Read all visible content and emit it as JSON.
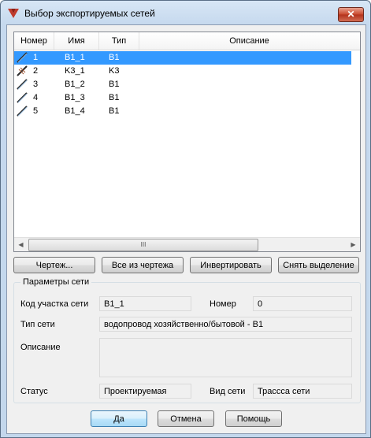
{
  "window": {
    "title": "Выбор экспортируемых сетей",
    "close_label": "✕"
  },
  "list": {
    "columns": [
      "Номер",
      "Имя",
      "Тип",
      "Описание"
    ],
    "rows": [
      {
        "num": "1",
        "name": "B1_1",
        "type": "B1",
        "desc": "",
        "icon": "pipe-icon",
        "selected": true
      },
      {
        "num": "2",
        "name": "K3_1",
        "type": "K3",
        "desc": "",
        "icon": "sewer-pipe-icon",
        "selected": false
      },
      {
        "num": "3",
        "name": "B1_2",
        "type": "B1",
        "desc": "",
        "icon": "pipe-icon",
        "selected": false
      },
      {
        "num": "4",
        "name": "B1_3",
        "type": "B1",
        "desc": "",
        "icon": "pipe-icon",
        "selected": false
      },
      {
        "num": "5",
        "name": "B1_4",
        "type": "B1",
        "desc": "",
        "icon": "pipe-icon",
        "selected": false
      }
    ],
    "scroll_left": "◀",
    "scroll_right": "▶",
    "scroll_grip": "III"
  },
  "actions": {
    "drawing": "Чертеж...",
    "all_from_drawing": "Все из чертежа",
    "invert": "Инвертировать",
    "deselect": "Снять выделение"
  },
  "params": {
    "group_title": "Параметры сети",
    "section_code_label": "Код участка сети",
    "section_code_value": "B1_1",
    "number_label": "Номер",
    "number_value": "0",
    "net_type_label": "Тип сети",
    "net_type_value": "водопровод хозяйственно/бытовой - B1",
    "description_label": "Описание",
    "description_value": "",
    "status_label": "Статус",
    "status_value": "Проектируемая",
    "net_view_label": "Вид сети",
    "net_view_value": "Трассса сети"
  },
  "footer": {
    "ok": "Да",
    "cancel": "Отмена",
    "help": "Помощь"
  },
  "colors": {
    "selection": "#3399ff",
    "accent": "#3c7fb1"
  }
}
